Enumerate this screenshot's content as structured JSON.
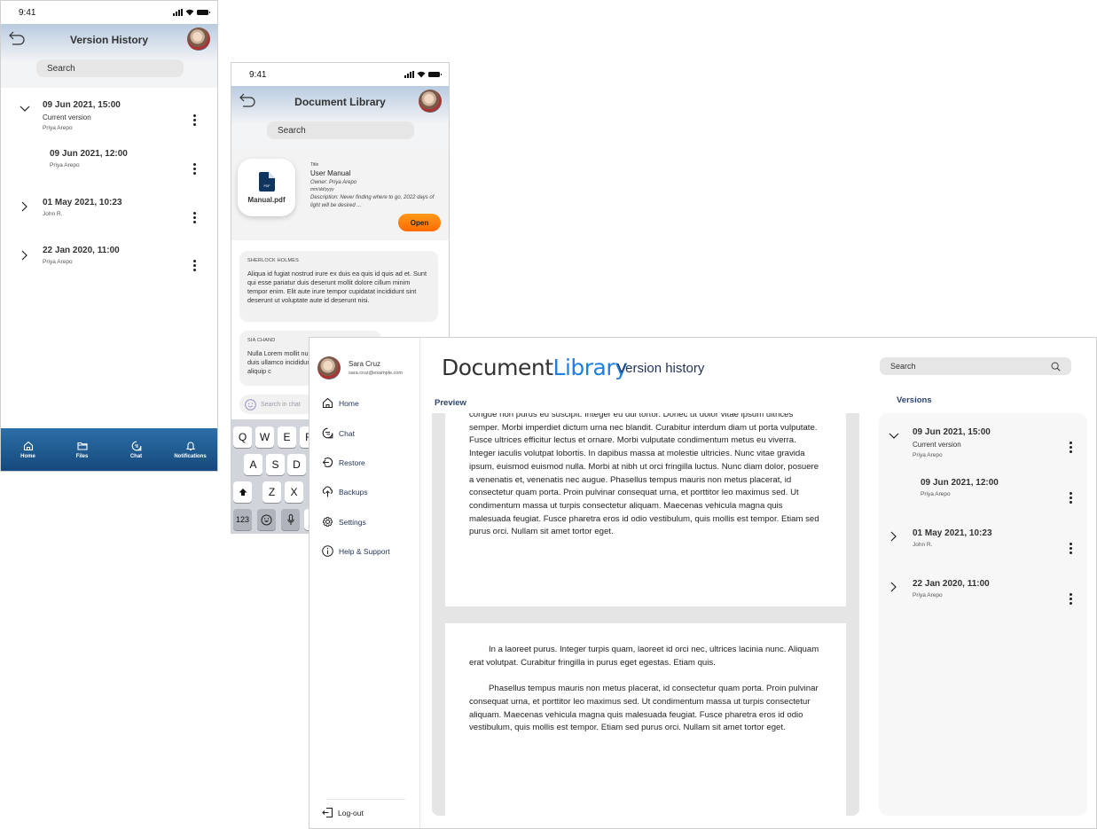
{
  "phone_version_history": {
    "status_time": "9:41",
    "title": "Version History",
    "search_placeholder": "Search",
    "versions": [
      {
        "date": "09 Jun 2021, 15:00",
        "subtitle": "Current version",
        "author": "Priya Arepo",
        "expanded": true
      },
      {
        "date": "09 Jun 2021, 12:00",
        "author": "Priya Arepo",
        "child": true
      },
      {
        "date": "01 May 2021, 10:23",
        "author": "John R.",
        "expanded": false
      },
      {
        "date": "22 Jan 2020, 11:00",
        "author": "Priya Arepo",
        "expanded": false
      }
    ],
    "bottom_nav": [
      {
        "label": "Home",
        "icon": "home-icon"
      },
      {
        "label": "Files",
        "icon": "folder-icon"
      },
      {
        "label": "Chat",
        "icon": "chat-icon"
      },
      {
        "label": "Notifications",
        "icon": "bell-icon"
      }
    ]
  },
  "phone_document_library": {
    "status_time": "9:41",
    "title": "Document Library",
    "search_placeholder": "Search",
    "document": {
      "file_name": "Manual.pdf",
      "file_badge": "PDF",
      "title_label": "Title",
      "title": "User Manual",
      "owner": "Owner: Priya Arepo",
      "date": "mm/dd/yyyy",
      "description": "Description: Never finding where to go, 2022 days of light will be desired ...",
      "open_label": "Open"
    },
    "messages": [
      {
        "author": "SHERLOCK HOLMES",
        "text": "Aliqua id fugiat nostrud irure ex duis ea quis id quis ad et. Sunt qui esse pariatur duis deserunt mollit dolore cillum minim tempor enim. Elit aute irure tempor cupidatat incididunt sint deserunt ut voluptate aute id deserunt nisi."
      },
      {
        "author": "SIA CHAND",
        "text": "Nulla Lorem mollit nulla duis ullamco incididunt aliquip c"
      }
    ],
    "chat_search_placeholder": "Search in chat",
    "keyboard": {
      "row1": [
        "Q",
        "W",
        "E",
        "R"
      ],
      "row2": [
        "A",
        "S",
        "D"
      ],
      "row3": [
        "Z",
        "X"
      ],
      "numbers_key": "123"
    }
  },
  "desktop": {
    "user": {
      "name": "Sara Cruz",
      "email": "sara.cruz@example.com"
    },
    "nav": [
      {
        "label": "Home",
        "icon": "home-icon"
      },
      {
        "label": "Chat",
        "icon": "chat-icon"
      },
      {
        "label": "Restore",
        "icon": "restore-icon"
      },
      {
        "label": "Backups",
        "icon": "cloud-upload-icon"
      },
      {
        "label": "Settings",
        "icon": "gear-icon"
      },
      {
        "label": "Help & Support",
        "icon": "info-icon"
      }
    ],
    "logout_label": "Log-out",
    "brand_part1": "Document",
    "brand_part2": "Library",
    "page_title": "Version history",
    "search_placeholder": "Search",
    "preview_label": "Preview",
    "versions_label": "Versions",
    "preview_page1": "congue non purus eu suscipit. Integer eu dui tortor. Donec ut dolor vitae ipsum ultrices semper. Morbi imperdiet dictum urna nec blandit. Curabitur interdum diam ut porta vulputate. Fusce ultrices efficitur lectus et ornare. Morbi vulputate condimentum metus eu viverra. Integer iaculis volutpat lobortis. In dapibus massa at molestie ultricies. Nunc vitae gravida ipsum, euismod euismod nulla. Morbi at nibh ut orci fringilla luctus. Nunc diam dolor, posuere a venenatis et, venenatis nec augue. Phasellus tempus mauris non metus placerat, id consectetur quam porta. Proin pulvinar consequat urna, et porttitor leo maximus sed. Ut condimentum massa ut turpis consectetur aliquam. Maecenas vehicula magna quis malesuada feugiat. Fusce pharetra eros id odio vestibulum, quis mollis est tempor. Etiam sed purus orci. Nullam sit amet tortor eget.",
    "preview_page2_p1": "In a laoreet purus. Integer turpis quam, laoreet id orci nec, ultrices lacinia nunc. Aliquam erat volutpat. Curabitur fringilla in purus eget egestas. Etiam quis.",
    "preview_page2_p2": "Phasellus tempus mauris non metus placerat, id consectetur quam porta. Proin pulvinar consequat urna, et porttitor leo maximus sed. Ut condimentum massa ut turpis consectetur aliquam. Maecenas vehicula magna quis malesuada feugiat. Fusce pharetra eros id odio vestibulum, quis mollis est tempor. Etiam sed purus orci. Nullam sit amet tortor eget.",
    "versions": [
      {
        "date": "09 Jun 2021, 15:00",
        "subtitle": "Current version",
        "author": "Priya Arepo",
        "expanded": true
      },
      {
        "date": "09 Jun 2021, 12:00",
        "author": "Priya Arepo",
        "child": true
      },
      {
        "date": "01 May 2021, 10:23",
        "author": "John R.",
        "expanded": false
      },
      {
        "date": "22 Jan 2020, 11:00",
        "author": "Priya Arepo",
        "expanded": false
      }
    ]
  },
  "colors": {
    "brand_blue": "#1e7fe0",
    "nav_text": "#1f3156",
    "open_button": "#ff7a00",
    "bottom_nav": "#1d5a92"
  }
}
